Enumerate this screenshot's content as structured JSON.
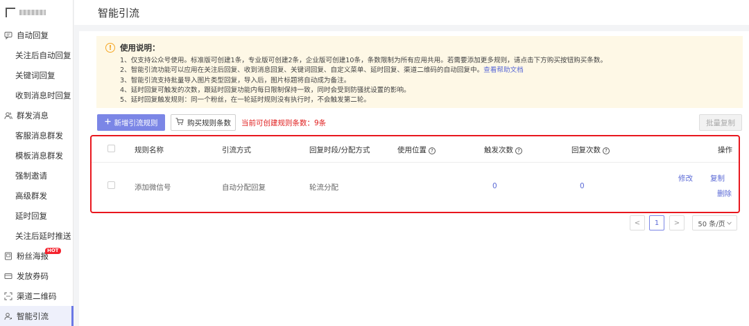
{
  "sidebar": {
    "groups": [
      {
        "label": "自动回复",
        "icon": "chat-bubble-icon",
        "items": [
          "关注后自动回复",
          "关键词回复",
          "收到消息时回复"
        ]
      },
      {
        "label": "群发消息",
        "icon": "users-icon",
        "items": [
          "客服消息群发",
          "模板消息群发",
          "强制邀请",
          "高级群发",
          "延时回复",
          "关注后延时推送"
        ]
      },
      {
        "label": "粉丝海报",
        "icon": "poster-icon",
        "badge": "HOT"
      },
      {
        "label": "发放券码",
        "icon": "coupon-icon"
      },
      {
        "label": "渠道二维码",
        "icon": "qrcode-icon"
      },
      {
        "label": "智能引流",
        "icon": "user-flow-icon",
        "active": true
      }
    ]
  },
  "header": {
    "title": "智能引流"
  },
  "notice": {
    "title": "使用说明：",
    "lines": [
      "1、仅支持公众号使用。标准版可创建1条，专业版可创建2条，企业版可创建10条，条数限制为所有应用共用。若需要添加更多规则，请点击下方购买按钮购买条数。",
      "2、智能引流功能可以应用在关注后回复、收到消息回复、关键词回复、自定义菜单、延时回复、渠道二维码的自动回复中。",
      "3、智能引流支持批量导入图片类型回复，导入后，图片标题将自动成为备注。",
      "4、延时回复可触发的次数，跟延时回复功能内每日限制保持一致，同时会受到防骚扰设置的影响。",
      "5、延时回复触发规则：同一个粉丝，在一轮延时规则没有执行时，不会触发第二轮。"
    ],
    "help_link": "查看帮助文档"
  },
  "toolbar": {
    "add_label": "新增引流规则",
    "buy_label": "购买规则条数",
    "quota_text": "当前可创建规则条数：9条",
    "batch_copy_label": "批量复制"
  },
  "table": {
    "columns": [
      "规则名称",
      "引流方式",
      "回复时段/分配方式",
      "使用位置",
      "触发次数",
      "回复次数",
      "操作"
    ],
    "rows": [
      {
        "name": "添加微信号",
        "method": "自动分配回复",
        "schedule": "轮流分配",
        "location": "",
        "trigger_count": "0",
        "reply_count": "0",
        "actions": [
          "修改",
          "复制",
          "删除"
        ]
      }
    ]
  },
  "pagination": {
    "prev": "<",
    "current_page": "1",
    "next": ">",
    "page_size": "50 条/页"
  },
  "colors": {
    "primary": "#7b86e6",
    "link": "#5b6ad6",
    "danger": "#e02020",
    "highlight_border": "#e8161d",
    "notice_bg": "#fef8e6"
  }
}
